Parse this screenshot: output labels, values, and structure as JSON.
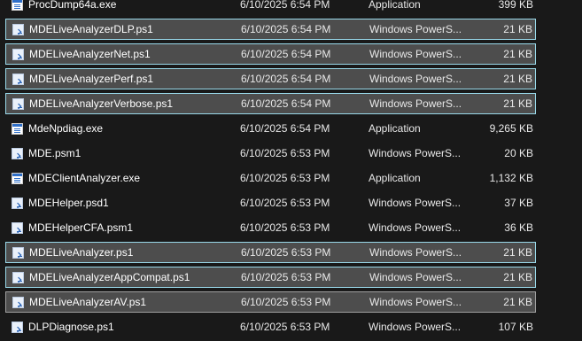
{
  "files": [
    {
      "name": "ProcDump64a.exe",
      "date": "6/10/2025 6:54 PM",
      "type": "Application",
      "size": "399 KB",
      "icon": "exe-icon",
      "selected": false
    },
    {
      "name": "MDELiveAnalyzerDLP.ps1",
      "date": "6/10/2025 6:54 PM",
      "type": "Windows PowerS...",
      "size": "21 KB",
      "icon": "powershell-script-icon",
      "selected": true
    },
    {
      "name": "MDELiveAnalyzerNet.ps1",
      "date": "6/10/2025 6:54 PM",
      "type": "Windows PowerS...",
      "size": "21 KB",
      "icon": "powershell-script-icon",
      "selected": true
    },
    {
      "name": "MDELiveAnalyzerPerf.ps1",
      "date": "6/10/2025 6:54 PM",
      "type": "Windows PowerS...",
      "size": "21 KB",
      "icon": "powershell-script-icon",
      "selected": true
    },
    {
      "name": "MDELiveAnalyzerVerbose.ps1",
      "date": "6/10/2025 6:54 PM",
      "type": "Windows PowerS...",
      "size": "21 KB",
      "icon": "powershell-script-icon",
      "selected": true
    },
    {
      "name": "MdeNpdiag.exe",
      "date": "6/10/2025 6:54 PM",
      "type": "Application",
      "size": "9,265 KB",
      "icon": "exe-icon",
      "selected": false
    },
    {
      "name": "MDE.psm1",
      "date": "6/10/2025 6:53 PM",
      "type": "Windows PowerS...",
      "size": "20 KB",
      "icon": "powershell-module-icon",
      "selected": false
    },
    {
      "name": "MDEClientAnalyzer.exe",
      "date": "6/10/2025 6:53 PM",
      "type": "Application",
      "size": "1,132 KB",
      "icon": "exe-icon",
      "selected": false
    },
    {
      "name": "MDEHelper.psd1",
      "date": "6/10/2025 6:53 PM",
      "type": "Windows PowerS...",
      "size": "37 KB",
      "icon": "powershell-module-icon",
      "selected": false
    },
    {
      "name": "MDEHelperCFA.psm1",
      "date": "6/10/2025 6:53 PM",
      "type": "Windows PowerS...",
      "size": "36 KB",
      "icon": "powershell-module-icon",
      "selected": false
    },
    {
      "name": "MDELiveAnalyzer.ps1",
      "date": "6/10/2025 6:53 PM",
      "type": "Windows PowerS...",
      "size": "21 KB",
      "icon": "powershell-script-icon",
      "selected": true
    },
    {
      "name": "MDELiveAnalyzerAppCompat.ps1",
      "date": "6/10/2025 6:53 PM",
      "type": "Windows PowerS...",
      "size": "21 KB",
      "icon": "powershell-script-icon",
      "selected": true
    },
    {
      "name": "MDELiveAnalyzerAV.ps1",
      "date": "6/10/2025 6:53 PM",
      "type": "Windows PowerS...",
      "size": "21 KB",
      "icon": "powershell-script-icon",
      "selected": true,
      "focus_dim": true
    },
    {
      "name": "DLPDiagnose.ps1",
      "date": "6/10/2025 6:53 PM",
      "type": "Windows PowerS...",
      "size": "107 KB",
      "icon": "powershell-script-icon",
      "selected": false
    }
  ],
  "colors": {
    "background": "#191919",
    "selection_fill": "#4d4d4d",
    "selection_border": "#99d9ea",
    "text": "#ffffff"
  }
}
